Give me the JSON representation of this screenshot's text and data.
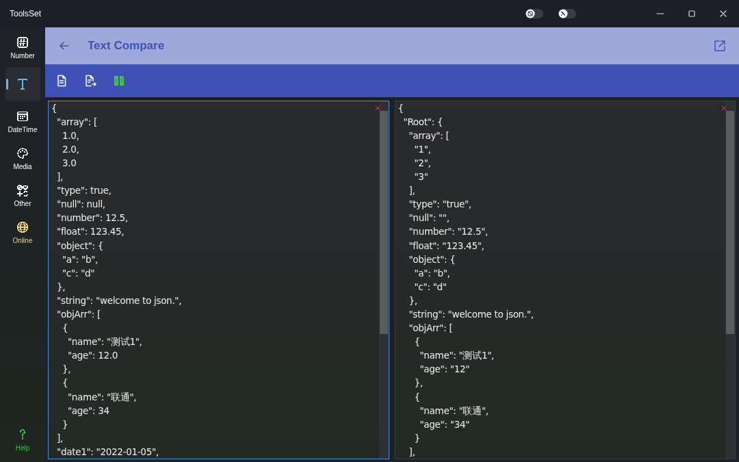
{
  "window": {
    "title": "ToolsSet",
    "toggles": [
      {
        "kind": "screen",
        "on": false
      },
      {
        "kind": "pin",
        "on": false
      }
    ]
  },
  "sidebar": {
    "items": [
      {
        "label": "Number",
        "kind": "hash",
        "selected": false,
        "color": "#ffffff"
      },
      {
        "kind": "text",
        "selected": true,
        "color": "#6cb4f0"
      },
      {
        "label": "DateTime",
        "kind": "calendar",
        "selected": false,
        "color": "#ffffff"
      },
      {
        "label": "Media",
        "kind": "palette",
        "selected": false,
        "color": "#ffffff"
      },
      {
        "label": "Other",
        "kind": "misc",
        "selected": false,
        "color": "#ffffff"
      },
      {
        "label": "Online",
        "kind": "globe",
        "selected": false,
        "color": "#f2d27a"
      }
    ],
    "help": {
      "label": "Help",
      "color": "#3fbf3f"
    }
  },
  "header": {
    "title": "Text Compare"
  },
  "toolbar": [
    {
      "kind": "doc"
    },
    {
      "kind": "export"
    },
    {
      "kind": "compare"
    }
  ],
  "editors": [
    {
      "focused": true,
      "lines": [
        "{",
        "  \"array\": [",
        "    1.0,",
        "    2.0,",
        "    3.0",
        "  ],",
        "  \"type\": true,",
        "  \"null\": null,",
        "  \"number\": 12.5,",
        "  \"float\": 123.45,",
        "  \"object\": {",
        "    \"a\": \"b\",",
        "    \"c\": \"d\"",
        "  },",
        "  \"string\": \"welcome to json.\",",
        "  \"objArr\": [",
        "    {",
        "      \"name\": \"测试1\",",
        "      \"age\": 12.0",
        "    },",
        "    {",
        "      \"name\": \"联通\",",
        "      \"age\": 34",
        "    }",
        "  ],",
        "  \"date1\": \"2022-01-05\","
      ]
    },
    {
      "focused": false,
      "lines": [
        "{",
        "  \"Root\": {",
        "    \"array\": [",
        "      \"1\",",
        "      \"2\",",
        "      \"3\"",
        "    ],",
        "    \"type\": \"true\",",
        "    \"null\": \"\",",
        "    \"number\": \"12.5\",",
        "    \"float\": \"123.45\",",
        "    \"object\": {",
        "      \"a\": \"b\",",
        "      \"c\": \"d\"",
        "    },",
        "    \"string\": \"welcome to json.\",",
        "    \"objArr\": [",
        "      {",
        "        \"name\": \"测试1\",",
        "        \"age\": \"12\"",
        "      },",
        "      {",
        "        \"name\": \"联通\",",
        "        \"age\": \"34\"",
        "      }",
        "    ],"
      ]
    }
  ]
}
